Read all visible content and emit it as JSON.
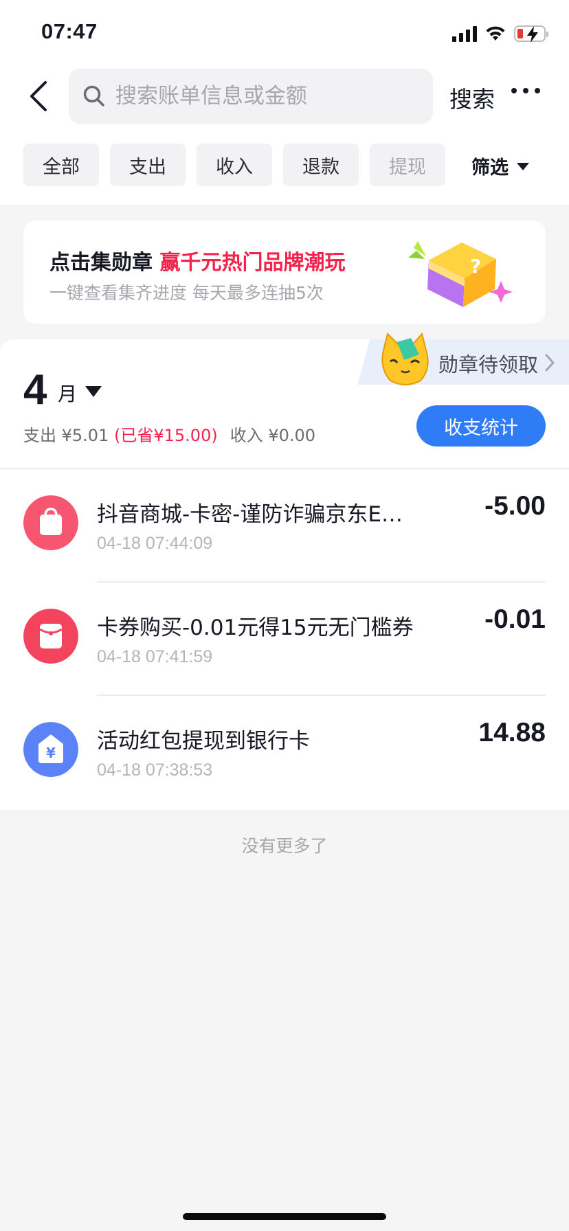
{
  "status_bar": {
    "time": "07:47"
  },
  "search": {
    "placeholder": "搜索账单信息或金额",
    "value": "",
    "button_label": "搜索"
  },
  "tabs": [
    {
      "label": "全部"
    },
    {
      "label": "支出"
    },
    {
      "label": "收入"
    },
    {
      "label": "退款"
    },
    {
      "label": "提现"
    }
  ],
  "filter": {
    "label": "筛选"
  },
  "banner": {
    "title_prefix": "点击集勋章",
    "title_highlight": "赢千元热门品牌潮玩",
    "subtitle": "一键查看集齐进度 每天最多连抽5次"
  },
  "badge": {
    "label": "勋章待领取"
  },
  "month": {
    "number": "4",
    "unit": "月",
    "expense_label": "支出",
    "expense_value": "¥5.01",
    "saved_text": "(已省¥15.00)",
    "income_label": "收入",
    "income_value": "¥0.00",
    "stats_button": "收支统计"
  },
  "transactions": [
    {
      "title": "抖音商城-卡密-谨防诈骗京东E…",
      "time": "04-18 07:44:09",
      "amount": "-5.00",
      "icon": "shopping-bag-icon",
      "icon_color": "#f6566f"
    },
    {
      "title": "卡券购买-0.01元得15元无门槛券",
      "time": "04-18 07:41:59",
      "amount": "-0.01",
      "icon": "red-envelope-icon",
      "icon_color": "#f2455d"
    },
    {
      "title": "活动红包提现到银行卡",
      "time": "04-18 07:38:53",
      "amount": "14.88",
      "icon": "house-yuan-icon",
      "icon_color": "#5b83f7"
    }
  ],
  "footer": {
    "no_more": "没有更多了"
  },
  "colors": {
    "accent_blue": "#2f7cf6",
    "highlight_red": "#f5224d"
  }
}
